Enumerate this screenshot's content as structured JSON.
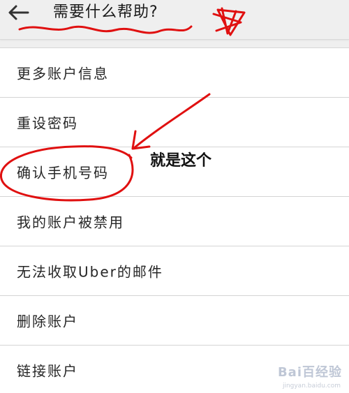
{
  "header": {
    "title": "需要什么帮助?",
    "back_icon": "arrow-left-icon"
  },
  "items": [
    {
      "label": "更多账户信息"
    },
    {
      "label": "重设密码"
    },
    {
      "label": "确认手机号码"
    },
    {
      "label": "我的账户被禁用"
    },
    {
      "label": "无法收取Uber的邮件"
    },
    {
      "label": "删除账户"
    },
    {
      "label": "链接账户"
    }
  ],
  "annotation": {
    "text": "就是这个",
    "ink_color": "#e01010"
  },
  "watermark": {
    "brand": "Bai百经验",
    "url": "jingyan.baidu.com"
  }
}
